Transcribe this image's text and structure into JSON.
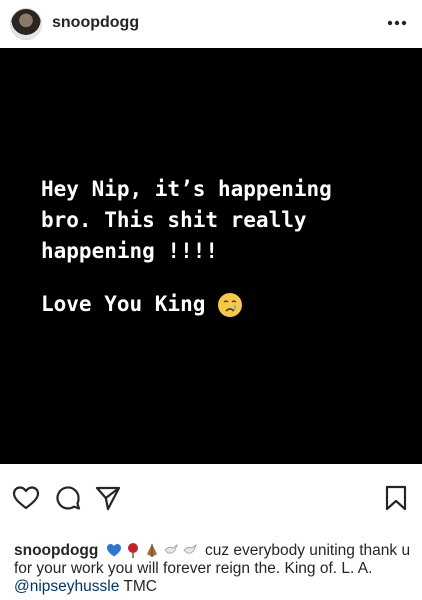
{
  "header": {
    "username": "snoopdogg",
    "more_icon": "more-horizontal-icon"
  },
  "post": {
    "background": "#000000",
    "text_lines": "Hey Nip, it’s happening\nbro. This shit really\nhappening !!!!",
    "text_line2": "Love You King",
    "emoji": "crying-face-emoji"
  },
  "actions": {
    "like_icon": "heart-icon",
    "comment_icon": "comment-icon",
    "share_icon": "share-icon",
    "save_icon": "bookmark-icon"
  },
  "caption": {
    "username": "snoopdogg",
    "emojis": [
      "blue-heart-emoji",
      "rose-emoji",
      "folded-hands-emoji",
      "dove-emoji",
      "dove-emoji"
    ],
    "text_after_emojis": "cuz everybody uniting thank u for your work you will forever reign the. King of.  L. A.",
    "mention": "@nipseyhussle",
    "tail": "TMC"
  },
  "colors": {
    "text": "#262626",
    "mention": "#003569"
  }
}
